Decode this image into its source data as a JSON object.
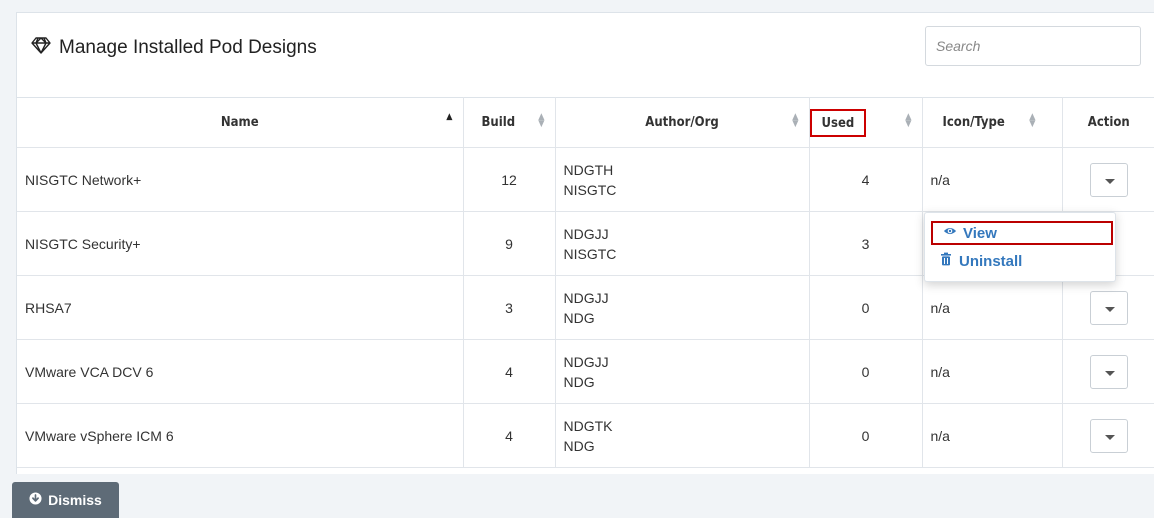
{
  "panel": {
    "title": "Manage Installed Pod Designs",
    "title_icon": "diamond-icon",
    "search_placeholder": "Search"
  },
  "table": {
    "columns": [
      "Name",
      "Build",
      "Author/Org",
      "Used",
      "Icon/Type",
      "Action"
    ],
    "sorted_column": "Name",
    "sort_direction": "ascending",
    "rows": [
      {
        "name": "NISGTC Network+",
        "build": "12",
        "author": "NDGTH",
        "org": "NISGTC",
        "used": "4",
        "icon_type": "n/a"
      },
      {
        "name": "NISGTC Security+",
        "build": "9",
        "author": "NDGJJ",
        "org": "NISGTC",
        "used": "3",
        "icon_type": ""
      },
      {
        "name": "RHSA7",
        "build": "3",
        "author": "NDGJJ",
        "org": "NDG",
        "used": "0",
        "icon_type": "n/a"
      },
      {
        "name": "VMware VCA DCV 6",
        "build": "4",
        "author": "NDGJJ",
        "org": "NDG",
        "used": "0",
        "icon_type": "n/a"
      },
      {
        "name": "VMware vSphere ICM 6",
        "build": "4",
        "author": "NDGTK",
        "org": "NDG",
        "used": "0",
        "icon_type": "n/a"
      }
    ]
  },
  "action_menu": {
    "view_label": "View",
    "uninstall_label": "Uninstall",
    "view_icon": "eye-icon",
    "uninstall_icon": "trash-icon"
  },
  "footer": {
    "dismiss_label": "Dismiss",
    "dismiss_icon": "arrow-circle-down-icon"
  },
  "colors": {
    "highlight_border": "#c00000",
    "link_blue": "#3478bd",
    "dismiss_bg": "#5e6b77"
  }
}
